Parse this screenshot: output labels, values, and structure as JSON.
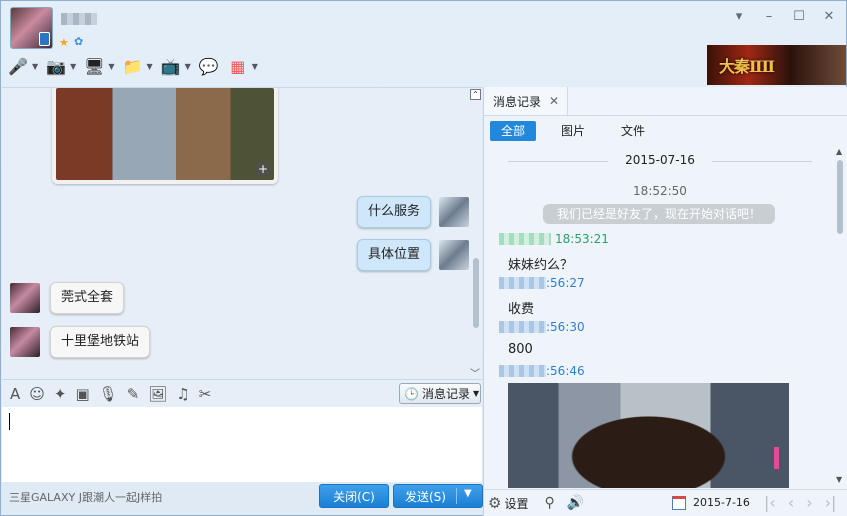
{
  "header": {
    "status_icons": [
      "star-icon",
      "qzone-icon"
    ],
    "window_controls": [
      "chevron-down-icon",
      "minimize-icon",
      "maximize-icon",
      "close-icon"
    ],
    "toolbar": [
      {
        "name": "voice-call-icon",
        "glyph": "🎤"
      },
      {
        "name": "video-call-icon",
        "glyph": "📷"
      },
      {
        "name": "remote-desktop-icon",
        "glyph": "🖥"
      },
      {
        "name": "send-file-icon",
        "glyph": "📁"
      },
      {
        "name": "screen-share-icon",
        "glyph": "📺"
      },
      {
        "name": "create-discussion-icon",
        "glyph": "💬"
      },
      {
        "name": "apps-icon",
        "glyph": "▦"
      }
    ],
    "ad_text": "大秦ⅡⅡ"
  },
  "chat": {
    "messages": [
      {
        "side": "me",
        "text": "什么服务"
      },
      {
        "side": "me",
        "text": "具体位置"
      },
      {
        "side": "them",
        "text": "莞式全套"
      },
      {
        "side": "them",
        "text": "十里堡地铁站"
      }
    ]
  },
  "input_toolbar": {
    "tools": [
      {
        "name": "font-icon",
        "glyph": "A"
      },
      {
        "name": "emoji-icon",
        "glyph": "☺"
      },
      {
        "name": "shake-icon",
        "glyph": "✦"
      },
      {
        "name": "gif-icon",
        "glyph": "▣"
      },
      {
        "name": "voice-message-icon",
        "glyph": "🎙"
      },
      {
        "name": "edit-icon",
        "glyph": "✎"
      },
      {
        "name": "image-icon",
        "glyph": "🖼"
      },
      {
        "name": "music-icon",
        "glyph": "♫"
      },
      {
        "name": "screenshot-icon",
        "glyph": "✂"
      }
    ],
    "history_label": "消息记录"
  },
  "footer": {
    "device_text": "三星GALAXY J跟潮人一起J样拍",
    "close_label": "关闭(C)",
    "send_label": "发送(S)"
  },
  "history_panel": {
    "tab_label": "消息记录",
    "filters": [
      "全部",
      "图片",
      "文件"
    ],
    "date": "2015-07-16",
    "system_time": "18:52:50",
    "system_message": "我们已经是好友了，现在开始对话吧！",
    "entries": [
      {
        "time": "18:53:21",
        "text": "妹妹约么？"
      },
      {
        "time": ":56:27",
        "text": "收费"
      },
      {
        "time": ":56:30",
        "text": "800"
      },
      {
        "time": ":56:46",
        "text": ""
      }
    ],
    "settings_label": "设置",
    "footer_date": "2015-7-16"
  }
}
